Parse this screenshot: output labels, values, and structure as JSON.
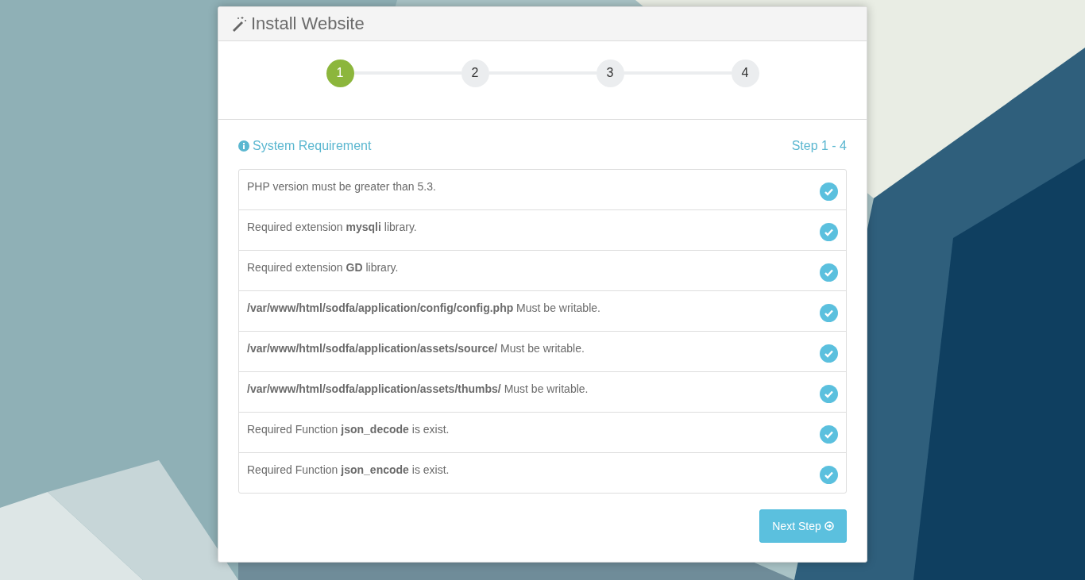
{
  "panel": {
    "title": "Install Website"
  },
  "steps": [
    {
      "label": "1",
      "selected": true
    },
    {
      "label": "2",
      "selected": false
    },
    {
      "label": "3",
      "selected": false
    },
    {
      "label": "4",
      "selected": false
    }
  ],
  "section": {
    "title": "System Requirement",
    "step_text": "Step 1 - 4"
  },
  "requirements": [
    {
      "text": "PHP version must be greater than 5.3.",
      "passed": true
    },
    {
      "text": "Required extension **mysqli** library.",
      "passed": true
    },
    {
      "text": "Required extension **GD** library.",
      "passed": true
    },
    {
      "text": "**/var/www/html/sodfa/application/config/config.php** Must be writable.",
      "passed": true
    },
    {
      "text": "**/var/www/html/sodfa/application/assets/source/** Must be writable.",
      "passed": true
    },
    {
      "text": "**/var/www/html/sodfa/application/assets/thumbs/** Must be writable.",
      "passed": true
    },
    {
      "text": "Required Function **json_decode** is exist.",
      "passed": true
    },
    {
      "text": "Required Function **json_encode** is exist.",
      "passed": true
    }
  ],
  "next_button": {
    "label": "Next Step"
  }
}
